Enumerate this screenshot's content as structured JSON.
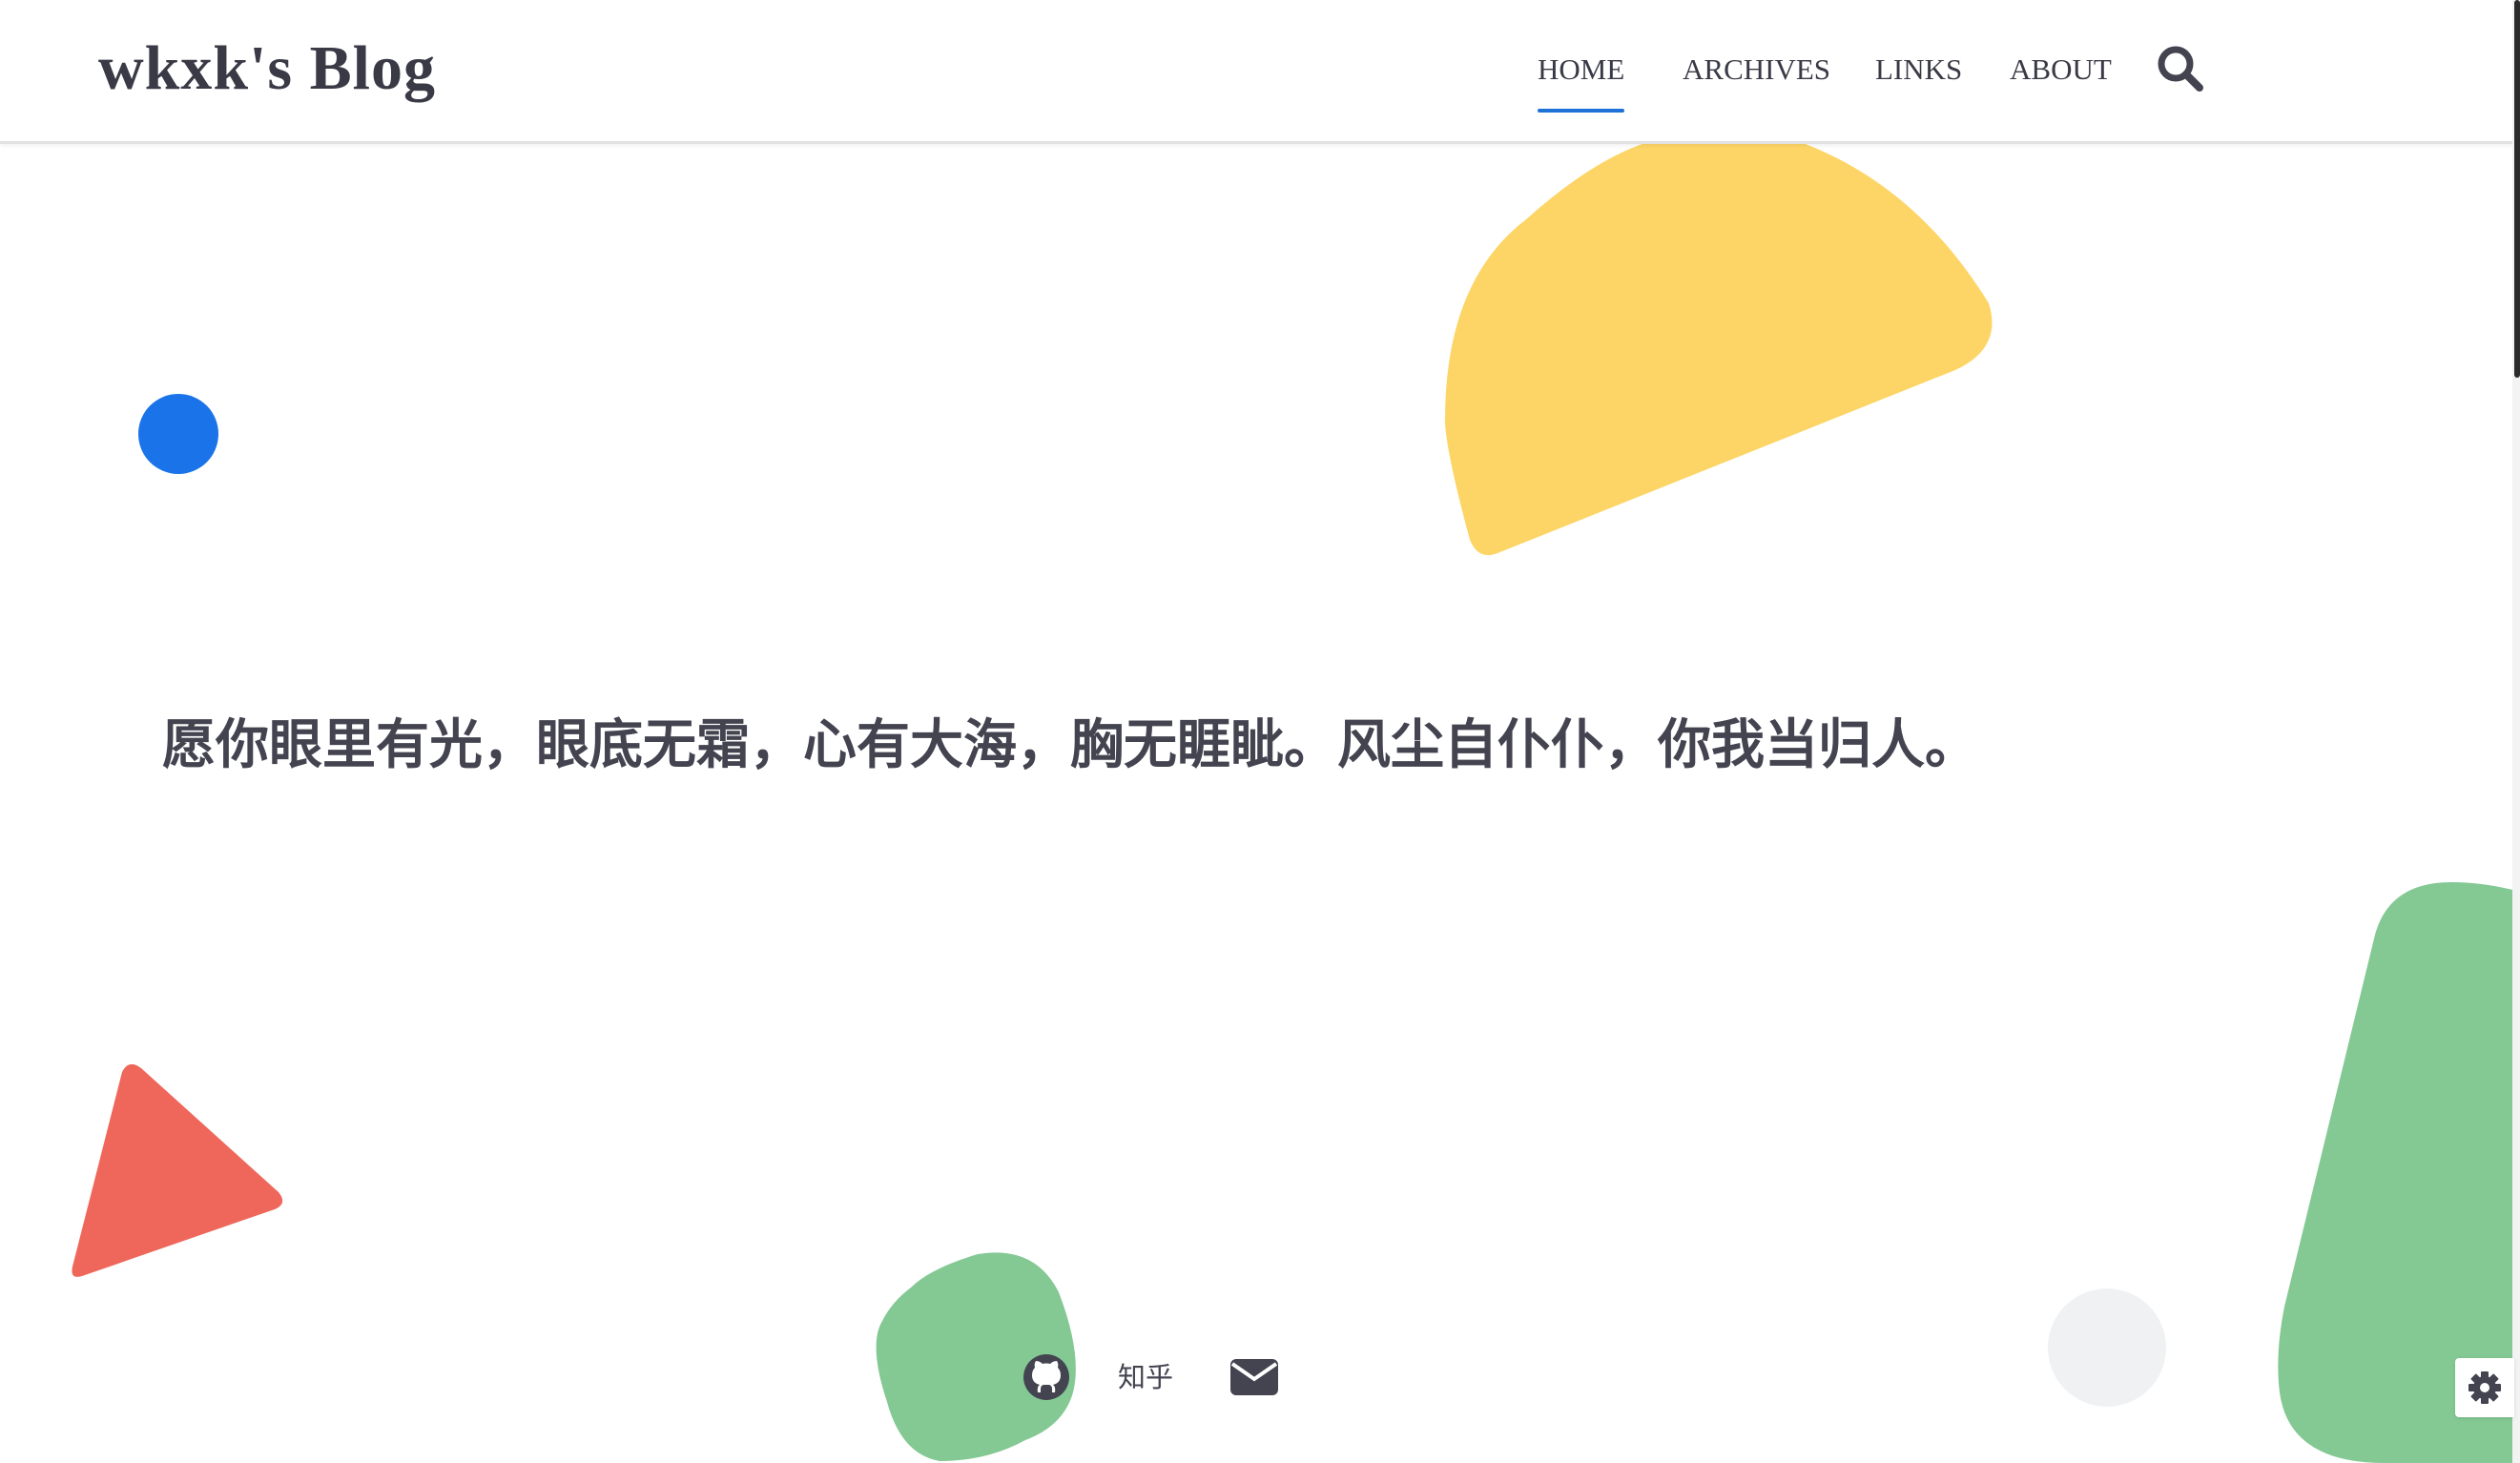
{
  "site": {
    "title": "wkxk's Blog"
  },
  "nav": {
    "items": [
      {
        "label": "HOME",
        "active": true
      },
      {
        "label": "ARCHIVES",
        "active": false
      },
      {
        "label": "LINKS",
        "active": false
      },
      {
        "label": "ABOUT",
        "active": false
      }
    ],
    "search_icon": "search-icon"
  },
  "hero": {
    "quote": "愿你眼里有光，眼底无霜，心有大海，胸无睚眦。风尘自仆仆，你我当归人。"
  },
  "social": {
    "github_icon": "github-icon",
    "zhihu_label": "知乎",
    "email_icon": "envelope-icon"
  },
  "settings": {
    "icon": "gear-icon"
  },
  "colors": {
    "text": "#444451",
    "accent": "#1e72d7",
    "yellow": "#fdd566",
    "blue": "#1a73e8",
    "red": "#ef675b",
    "green": "#84c994",
    "gray": "#f0f1f3"
  }
}
